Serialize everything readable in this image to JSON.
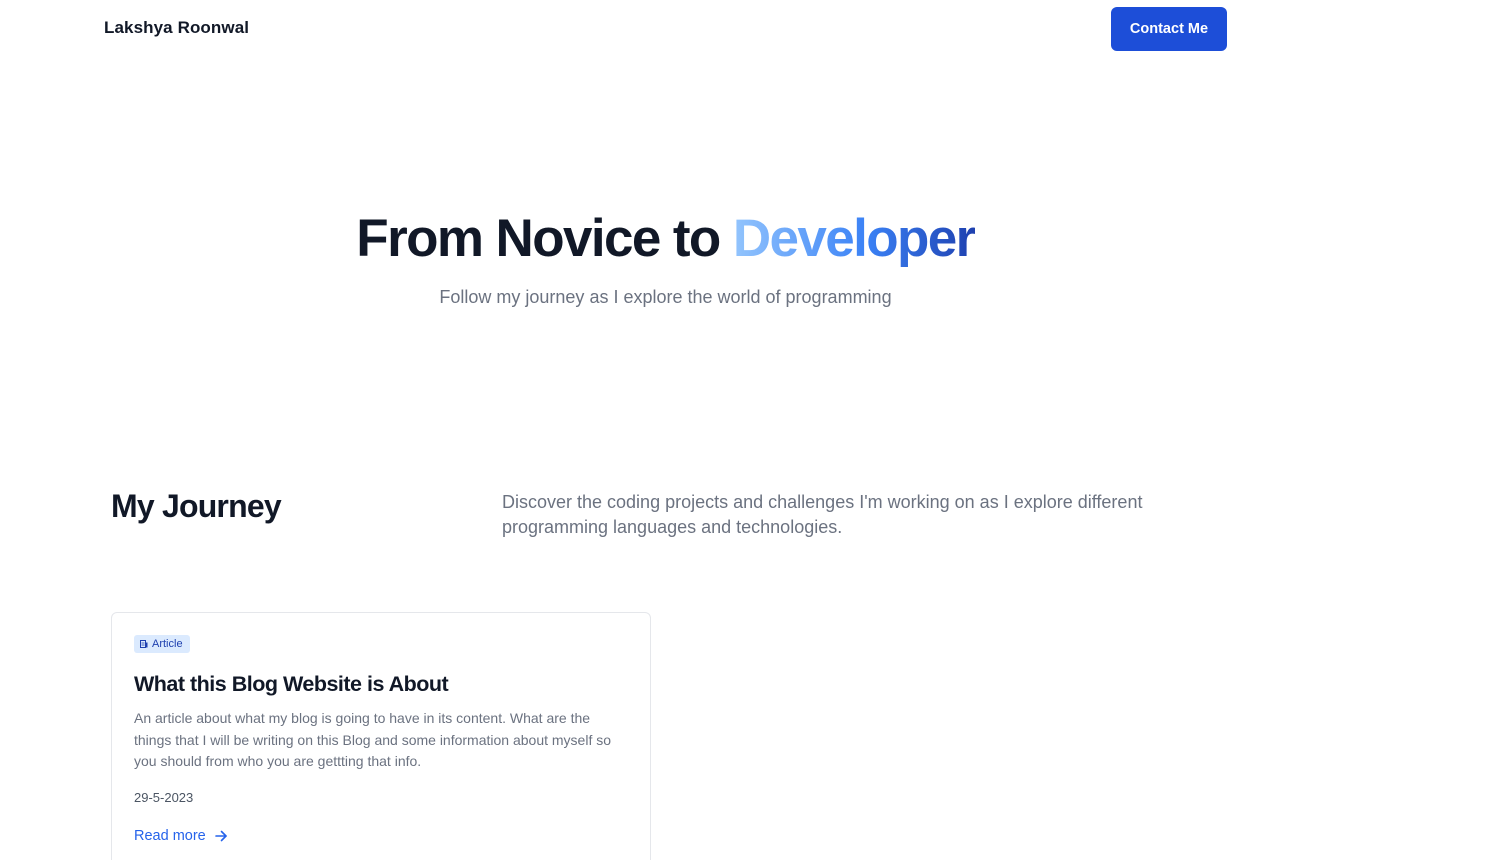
{
  "header": {
    "brand": "Lakshya Roonwal",
    "contact_label": "Contact Me"
  },
  "hero": {
    "title_prefix": "From Novice to ",
    "title_accent": "Developer",
    "subtitle": "Follow my journey as I explore the world of programming"
  },
  "journey": {
    "title": "My Journey",
    "description": "Discover the coding projects and challenges I'm working on as I explore different programming languages and technologies."
  },
  "posts": [
    {
      "badge": "Article",
      "badge_icon": "document-icon",
      "title": "What this Blog Website is About",
      "excerpt": "An article about what my blog is going to have in its content. What are the things that I will be writing on this Blog and some information about myself so you should from who you are gettting that info.",
      "date": "29-5-2023",
      "read_more": "Read more",
      "read_more_icon": "arrow-right-icon"
    }
  ],
  "colors": {
    "primary": "#1d4ed8",
    "link": "#2563eb",
    "badge_bg": "#dbeafe",
    "heading": "#111827",
    "muted": "#6b7280",
    "accent_gradient_start": "#93c5fd",
    "accent_gradient_end": "#1e40af"
  }
}
